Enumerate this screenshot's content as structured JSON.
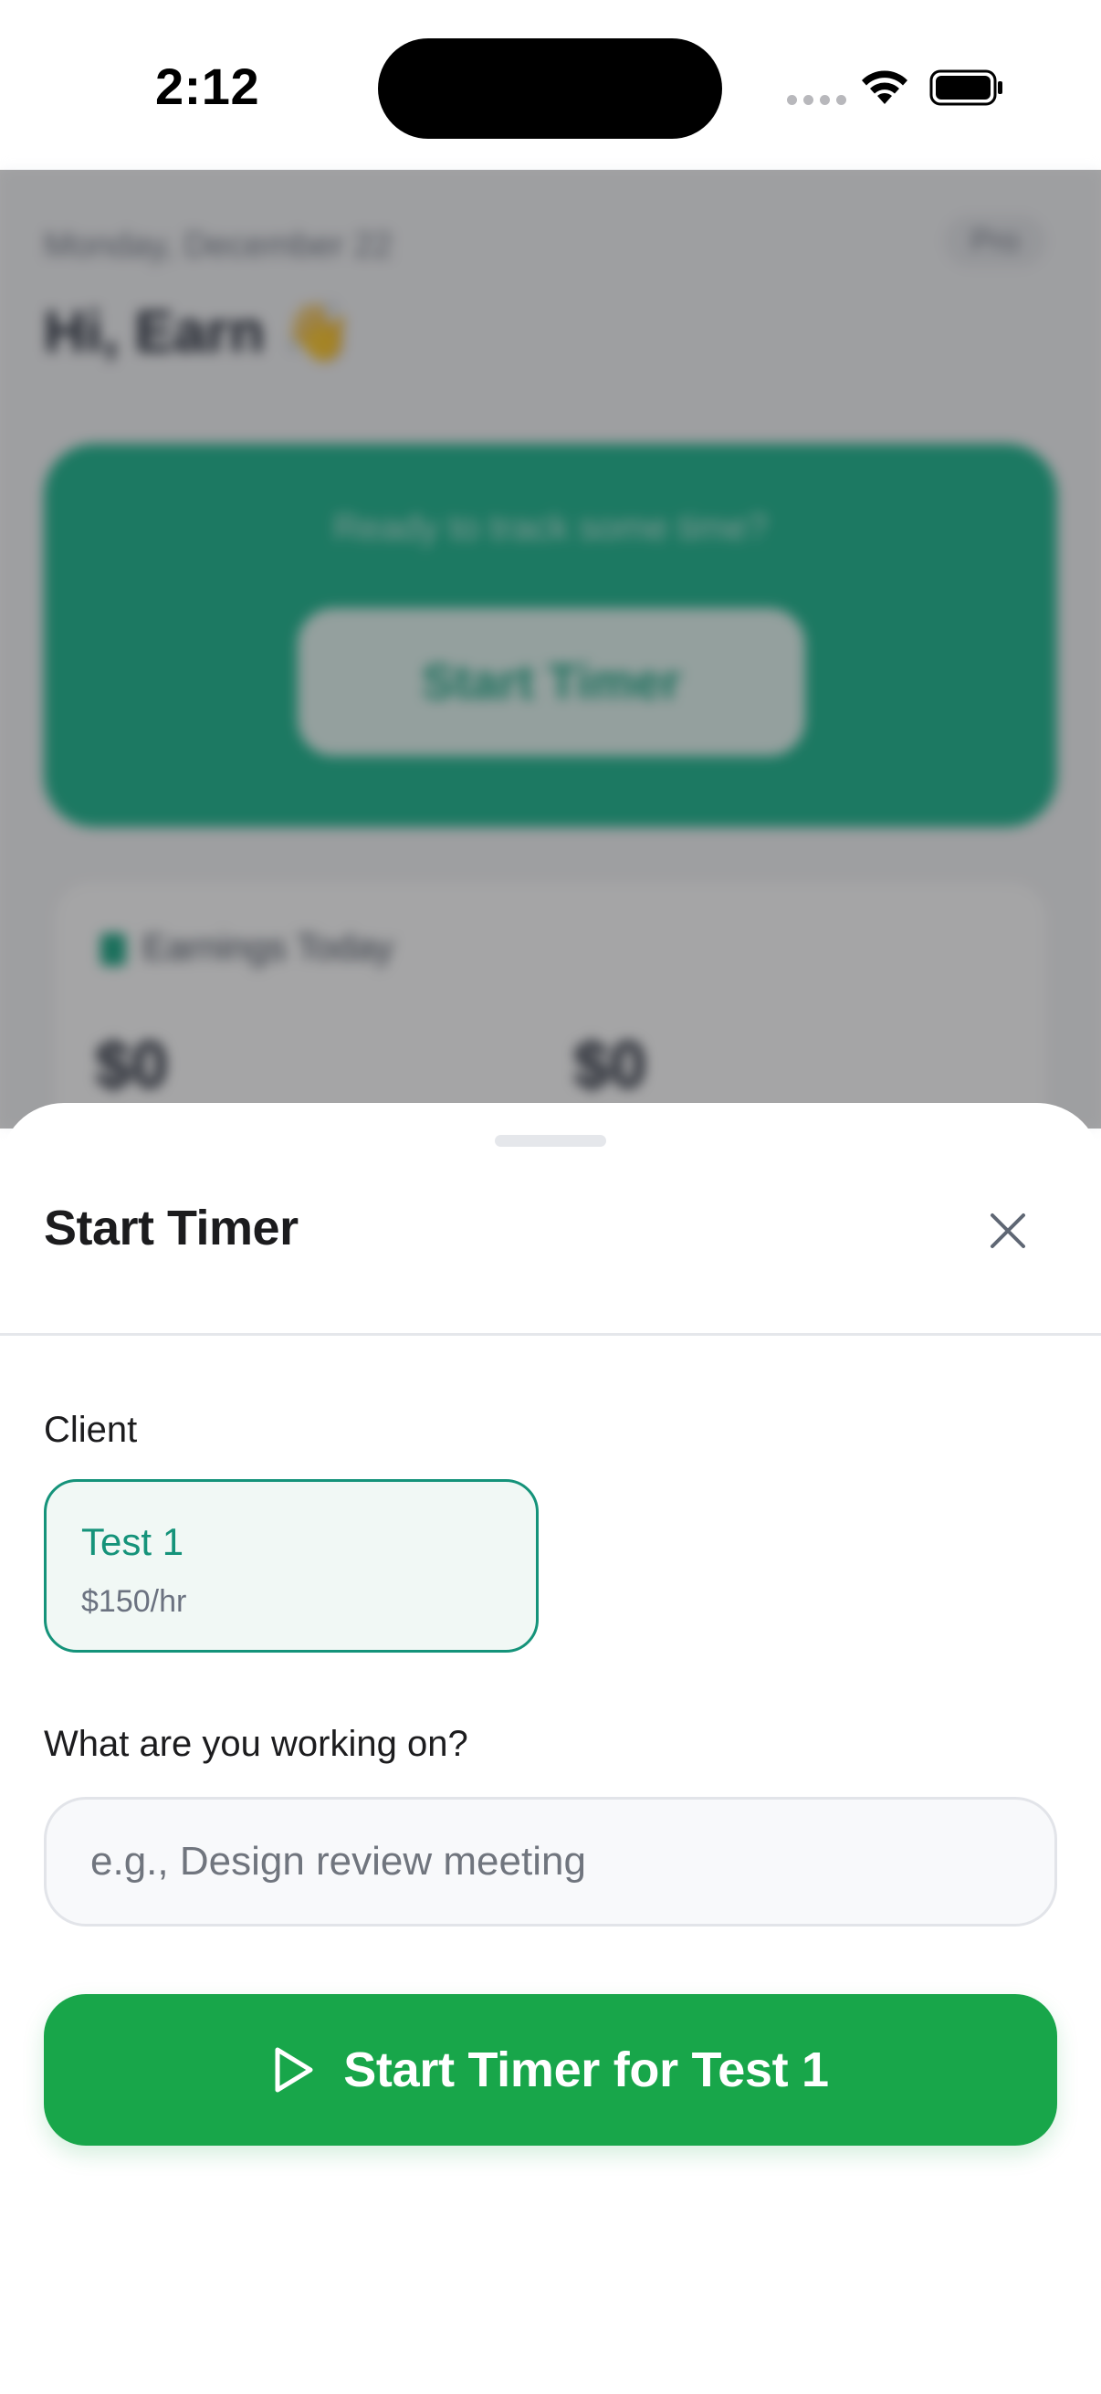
{
  "status_bar": {
    "time": "2:12"
  },
  "background_app": {
    "date": "Monday, December 22",
    "chip": "Pro",
    "greeting": "Hi, Earn",
    "greeting_emoji": "👋",
    "hero_prompt": "Ready to track some time?",
    "hero_button": "Start Timer",
    "earnings_title": "Earnings Today",
    "earnings_value_1": "$0",
    "earnings_value_2": "$0"
  },
  "sheet": {
    "title": "Start Timer",
    "client_label": "Client",
    "clients": [
      {
        "name": "Test 1",
        "rate": "$150/hr",
        "selected": true
      }
    ],
    "task_label": "What are you working on?",
    "task_input": {
      "value": "",
      "placeholder": "e.g., Design review meeting"
    },
    "start_button_label": "Start Timer for Test 1"
  },
  "colors": {
    "accent_teal": "#15937a",
    "start_green": "#18a64a",
    "hero_teal": "#14b38a"
  },
  "icons": {
    "close": "close-icon",
    "play": "play-icon"
  }
}
